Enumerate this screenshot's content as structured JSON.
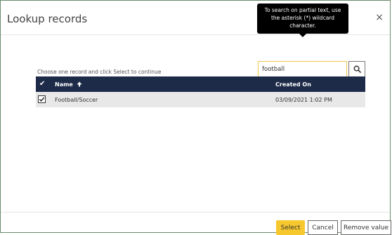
{
  "dialog": {
    "title": "Lookup records",
    "close_label": "×"
  },
  "tooltip": {
    "text": "To search on partial text, use the asterisk (*) wildcard character."
  },
  "search": {
    "value": "football",
    "icon": "search-icon"
  },
  "instruction": "Choose one record and click Select to continue",
  "grid": {
    "header_check_icon": "checkmark-icon",
    "columns": [
      {
        "label": "Name",
        "sort_icon": "arrow-up-icon"
      },
      {
        "label": "Created On"
      }
    ],
    "rows": [
      {
        "name": "Football/Soccer",
        "created_on": "03/09/2021 1:02 PM",
        "selected": true
      }
    ]
  },
  "footer": {
    "select_label": "Select",
    "cancel_label": "Cancel",
    "remove_label": "Remove value"
  },
  "colors": {
    "header_bg": "#1d2b49",
    "accent_yellow": "#f7c72e",
    "row_selected_bg": "#e8e8e8"
  }
}
